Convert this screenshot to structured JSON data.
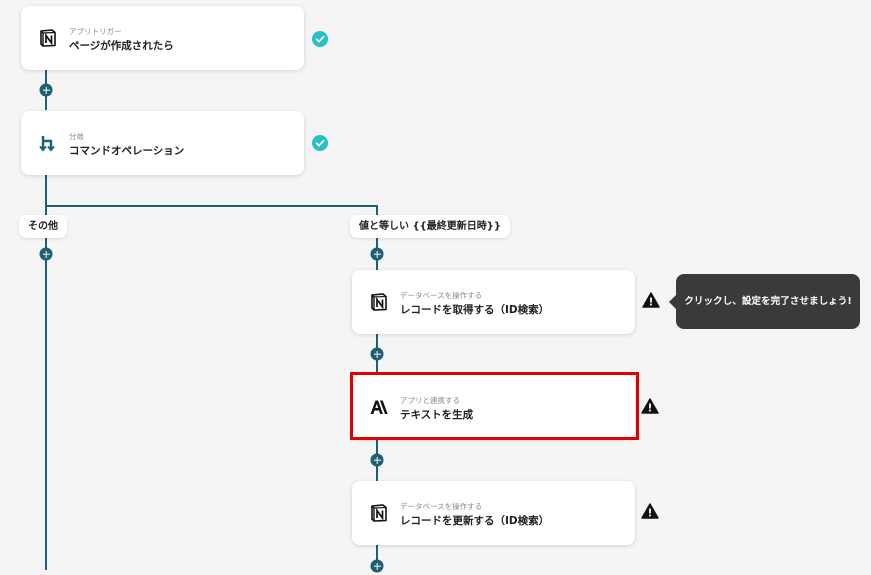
{
  "steps": {
    "trigger": {
      "subtitle": "アプリトリガー",
      "title": "ページが作成されたら",
      "icon": "notion-icon"
    },
    "branch": {
      "subtitle": "分岐",
      "title": "コマンドオペレーション",
      "icon": "branch-icon"
    }
  },
  "branches": {
    "left_label": "その他",
    "right_label": "値と等しい {{最終更新日時}}"
  },
  "actions": [
    {
      "subtitle": "データベースを操作する",
      "title": "レコードを取得する（ID検索）",
      "icon": "notion-icon"
    },
    {
      "subtitle": "アプリと連携する",
      "title": "テキストを生成",
      "icon": "anthropic-icon"
    },
    {
      "subtitle": "データベースを操作する",
      "title": "レコードを更新する（ID検索）",
      "icon": "notion-icon"
    }
  ],
  "tooltip": {
    "text": "クリックし、設定を完了させましょう!"
  },
  "colors": {
    "connector": "#1d5f73",
    "check": "#27c0c8",
    "highlight": "#e00000",
    "tooltip_bg": "#3a3a3a"
  }
}
